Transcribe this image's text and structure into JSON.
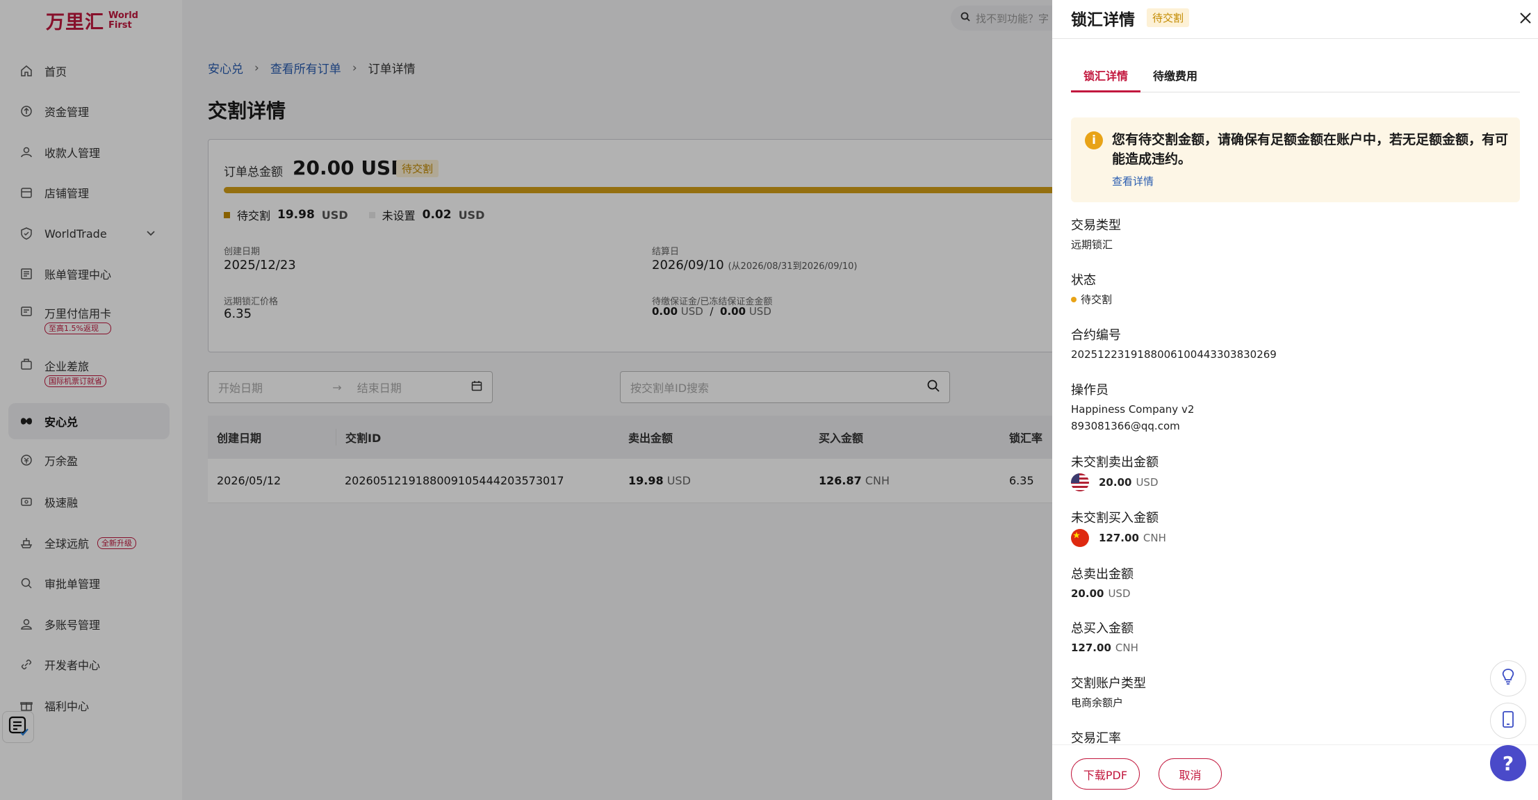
{
  "brand": {
    "name_cn": "万里汇",
    "name_en_1": "World",
    "name_en_2": "First"
  },
  "sidebar": {
    "items": [
      {
        "label": "首页"
      },
      {
        "label": "资金管理"
      },
      {
        "label": "收款人管理"
      },
      {
        "label": "店铺管理"
      },
      {
        "label": "WorldTrade"
      },
      {
        "label": "账单管理中心"
      },
      {
        "label": "万里付信用卡",
        "badge": "至高1.5%返现"
      },
      {
        "label": "企业差旅",
        "badge": "国际机票订就省"
      },
      {
        "label": "安心兑"
      },
      {
        "label": "万余盈"
      },
      {
        "label": "极速融"
      },
      {
        "label": "全球远航",
        "badge": "全新升级"
      },
      {
        "label": "审批单管理"
      },
      {
        "label": "多账号管理"
      },
      {
        "label": "开发者中心"
      },
      {
        "label": "福利中心"
      }
    ]
  },
  "topbar": {
    "search_placeholder": "找不到功能？字"
  },
  "breadcrumb": {
    "b1": "安心兑",
    "b2": "查看所有订单",
    "b3": "订单详情"
  },
  "page": {
    "title": "交割详情",
    "summary": {
      "total_label": "订单总金额",
      "total_amount": "20.00 USD",
      "status": "待交割",
      "pending_label": "待交割",
      "pending_amount": "19.98",
      "pending_ccy": "USD",
      "unset_label": "未设置",
      "unset_amount": "0.02",
      "unset_ccy": "USD",
      "created_label": "创建日期",
      "created_value": "2025/12/23",
      "settle_label": "结算日",
      "settle_value": "2026/09/10",
      "settle_range": "(从2026/08/31到2026/09/10)",
      "price_label": "远期锁汇价格",
      "price_value": "6.35",
      "margin_label": "待缴保证金/已冻结保证金金额",
      "margin_a": "0.00",
      "margin_a_ccy": "USD",
      "margin_sep": "/",
      "margin_b": "0.00",
      "margin_b_ccy": "USD"
    },
    "filters": {
      "start_placeholder": "开始日期",
      "end_placeholder": "结束日期",
      "range_arrow": "→",
      "search_placeholder": "按交割单ID搜索"
    },
    "table": {
      "headers": [
        "创建日期",
        "交割ID",
        "卖出金额",
        "买入金额",
        "锁汇率"
      ],
      "rows": [
        {
          "date": "2026/05/12",
          "id": "2026051219188009105444203573017",
          "sell": "19.98",
          "sell_ccy": "USD",
          "buy": "126.87",
          "buy_ccy": "CNH",
          "rate": "6.35"
        }
      ]
    }
  },
  "drawer": {
    "title": "锁汇详情",
    "status": "待交割",
    "tabs": [
      "锁汇详情",
      "待缴费用"
    ],
    "alert": {
      "text": "您有待交割金额，请确保有足额金额在账户中，若无足额金额，有可能造成违约。",
      "link": "查看详情"
    },
    "fields": {
      "type_label": "交易类型",
      "type_value": "远期锁汇",
      "status_label": "状态",
      "status_value": "待交割",
      "contract_label": "合约编号",
      "contract_value": "2025122319188006100443303830269",
      "operator_label": "操作员",
      "operator_name": "Happiness Company v2",
      "operator_email": "893081366@qq.com",
      "unsold_label": "未交割卖出金额",
      "unsold_amount": "20.00",
      "unsold_ccy": "USD",
      "unbought_label": "未交割买入金额",
      "unbought_amount": "127.00",
      "unbought_ccy": "CNH",
      "total_sell_label": "总卖出金额",
      "total_sell_amount": "20.00",
      "total_sell_ccy": "USD",
      "total_buy_label": "总买入金额",
      "total_buy_amount": "127.00",
      "total_buy_ccy": "CNH",
      "account_type_label": "交割账户类型",
      "account_type_value": "电商余额户",
      "rate_label": "交易汇率"
    },
    "footer": {
      "download": "下载PDF",
      "cancel": "取消"
    }
  },
  "fabs": {
    "help": "?"
  },
  "colors": {
    "brand": "#c2183e",
    "pending": "#e8a317",
    "link": "#2a5db0",
    "help": "#4a4ac9"
  }
}
